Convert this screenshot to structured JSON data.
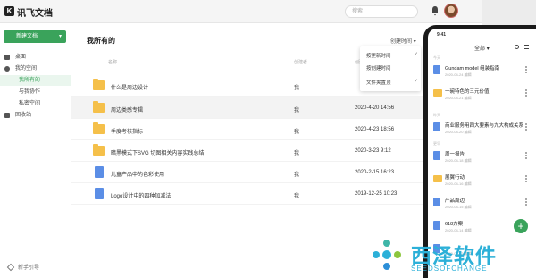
{
  "app": {
    "name": "讯飞文档",
    "logo_letter": "K",
    "search_placeholder": "搜索"
  },
  "sidebar": {
    "new_doc_label": "新建文档",
    "items": [
      {
        "label": "桌面",
        "icon": "desktop-icon"
      },
      {
        "label": "我的空间",
        "icon": "space-icon"
      },
      {
        "label": "我所有的",
        "active": true
      },
      {
        "label": "与我协作"
      },
      {
        "label": "私密空间"
      },
      {
        "label": "回收站",
        "icon": "trash-icon"
      }
    ],
    "guide_label": "新手引导"
  },
  "main": {
    "title": "我所有的",
    "sort_label": "创建时间",
    "columns": {
      "name": "名称",
      "creator": "创建者",
      "time": "创建时间"
    },
    "rows": [
      {
        "type": "folder",
        "name": "什么是周边设计",
        "creator": "我",
        "time": ""
      },
      {
        "type": "folder",
        "name": "周边类感专辑",
        "creator": "我",
        "time": "2020-4-20 14:56"
      },
      {
        "type": "folder",
        "name": "季度考核指标",
        "creator": "我",
        "time": "2020-4-23 18:56"
      },
      {
        "type": "folder",
        "name": "暗黑模式下SVG 切图相关内容实践总结",
        "creator": "我",
        "time": "2020-3-23 9:12"
      },
      {
        "type": "doc",
        "name": "儿童产品中的色彩使用",
        "creator": "我",
        "time": "2020-2-15 16:23"
      },
      {
        "type": "doc",
        "name": "Logo设计中的四种加减法",
        "creator": "我",
        "time": "2019-12-25 10:23"
      }
    ],
    "dropdown": [
      {
        "label": "按更新时间",
        "checked": true
      },
      {
        "label": "按创建时间",
        "checked": false
      },
      {
        "label": "文件夹置顶",
        "checked": true
      }
    ]
  },
  "phone": {
    "time": "9:41",
    "tab": "全部",
    "items": [
      {
        "type": "doc",
        "name": "Gundam model 组装指南",
        "sub": "2020-04-24 编辑"
      },
      {
        "type": "folder",
        "name": "一碗特色的三元价值",
        "sub": "2020-04-21 编辑"
      },
      {
        "type": "doc",
        "name": "商业服务用四大要素与九大构成关系",
        "sub": "2020-04-20 编辑"
      },
      {
        "type": "doc",
        "name": "周一报告",
        "sub": "2020-04-18 编辑"
      },
      {
        "type": "folder",
        "name": "展翼行动",
        "sub": "2020-04-16 编辑"
      },
      {
        "type": "doc",
        "name": "产品周边",
        "sub": "2020-04-15 编辑"
      },
      {
        "type": "doc",
        "name": "618方案",
        "sub": "2020-04-14 编辑"
      },
      {
        "type": "doc",
        "name": "",
        "sub": "2020-04-12 编辑"
      }
    ],
    "labels": [
      "今天",
      "昨天",
      "更早"
    ]
  },
  "watermark": {
    "cn": "西泽软件",
    "en": "SEEDSOFCHANGE"
  }
}
